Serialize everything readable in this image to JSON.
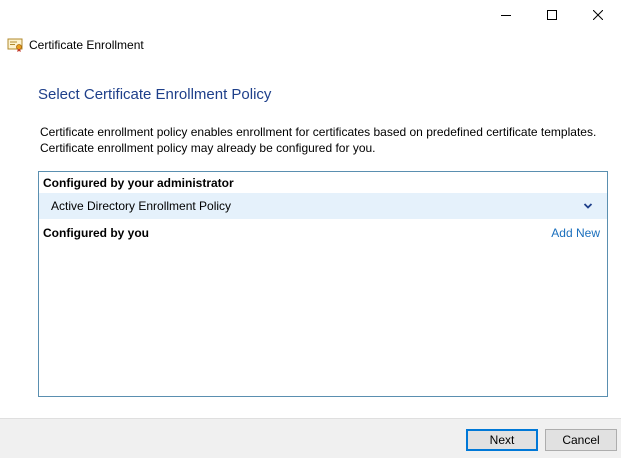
{
  "window": {
    "title": "Certificate Enrollment",
    "controls": [
      "minimize-icon",
      "maximize-icon",
      "close-icon"
    ]
  },
  "page": {
    "heading": "Select Certificate Enrollment Policy",
    "description_line1": "Certificate enrollment policy enables enrollment for certificates based on predefined certificate templates.",
    "description_line2": "Certificate enrollment policy may already be configured for you."
  },
  "policies": {
    "admin_header": "Configured by your administrator",
    "admin_items": [
      {
        "label": "Active Directory Enrollment Policy",
        "icon": "chevron-down-icon"
      }
    ],
    "user_header": "Configured by you",
    "add_new_label": "Add New"
  },
  "footer": {
    "next_label": "Next",
    "cancel_label": "Cancel"
  },
  "colors": {
    "heading": "#1e3f8a",
    "link": "#1a6fbd",
    "selected_row": "#e5f1fb",
    "box_border": "#5a8fb0",
    "footer_bg": "#f0f0f0"
  }
}
